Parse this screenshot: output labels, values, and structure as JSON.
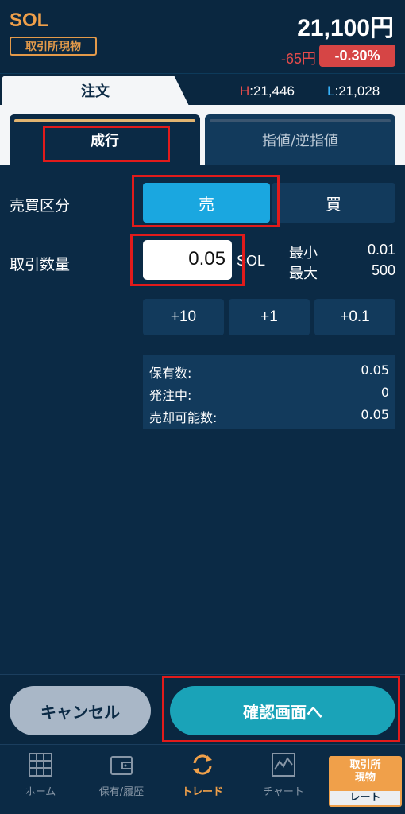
{
  "header": {
    "symbol": "SOL",
    "market_badge": "取引所現物",
    "price": "21,100円",
    "change": "-65円",
    "change_pct": "-0.30%"
  },
  "order_row": {
    "tab_label": "注文",
    "high_label": "H",
    "high_value": ":21,446",
    "low_label": "L",
    "low_value": ":21,028"
  },
  "type_tabs": {
    "market": "成行",
    "limit": "指値/逆指値"
  },
  "form": {
    "side_label": "売買区分",
    "sell": "売",
    "buy": "買",
    "qty_label": "取引数量",
    "qty_value": "0.05",
    "unit": "SOL",
    "min_label": "最小",
    "min_value": "0.01",
    "max_label": "最大",
    "max_value": "500",
    "steps": [
      "+10",
      "+1",
      "+0.1"
    ]
  },
  "holdings": {
    "held_label": "保有数:",
    "held_value": "0.05",
    "ordering_label": "発注中:",
    "ordering_value": "0",
    "sellable_label": "売却可能数:",
    "sellable_value": "0.05"
  },
  "actions": {
    "cancel": "キャンセル",
    "confirm": "確認画面へ"
  },
  "nav": {
    "items": [
      {
        "label": "ホーム",
        "icon": "grid-icon"
      },
      {
        "label": "保有/履歴",
        "icon": "wallet-icon"
      },
      {
        "label": "トレード",
        "icon": "refresh-arrows-icon"
      },
      {
        "label": "チャート",
        "icon": "chart-icon"
      }
    ],
    "market_top": "取引所\n現物",
    "market_bottom": "レート"
  },
  "colors": {
    "bg": "#0b2a45",
    "accent_orange": "#f0a04a",
    "sell_blue": "#1aa7e0",
    "confirm_teal": "#1aa3b8",
    "down_red": "#d64545",
    "highlight_red": "#e21b1b"
  }
}
